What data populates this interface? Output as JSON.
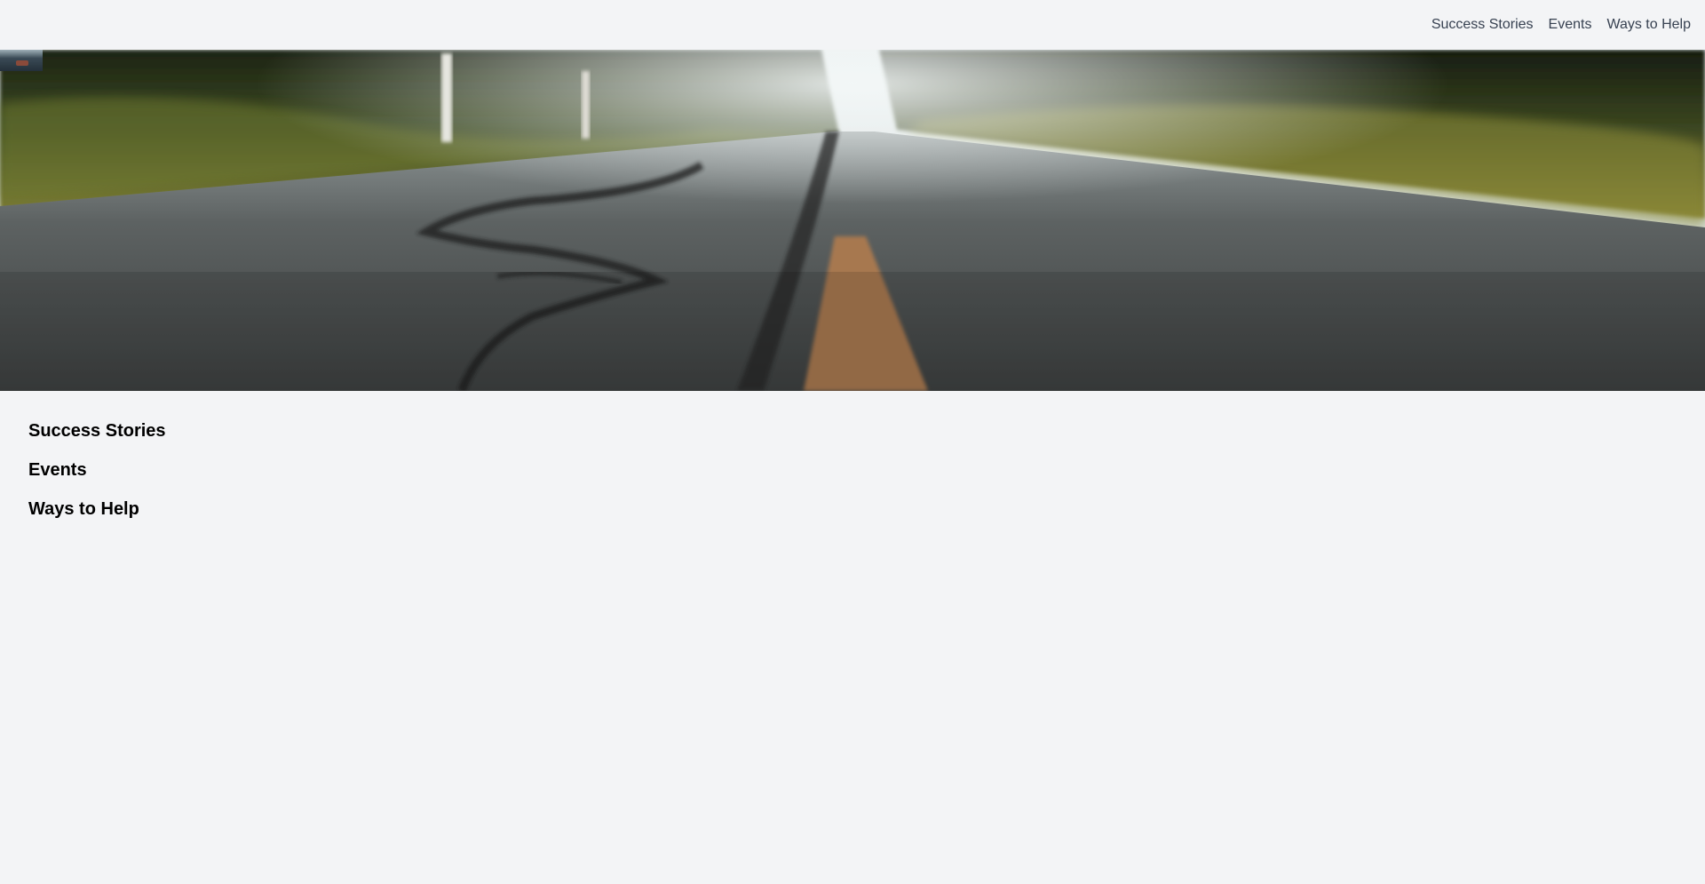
{
  "nav": {
    "links": [
      {
        "label": "Success Stories"
      },
      {
        "label": "Events"
      },
      {
        "label": "Ways to Help"
      }
    ]
  },
  "hero": {
    "image": "road-through-forest-photo"
  },
  "sections": [
    {
      "heading": "Success Stories"
    },
    {
      "heading": "Events"
    },
    {
      "heading": "Ways to Help"
    }
  ],
  "colors": {
    "page_background": "#f3f4f6",
    "nav_text": "#374151",
    "heading_text": "#000000"
  }
}
